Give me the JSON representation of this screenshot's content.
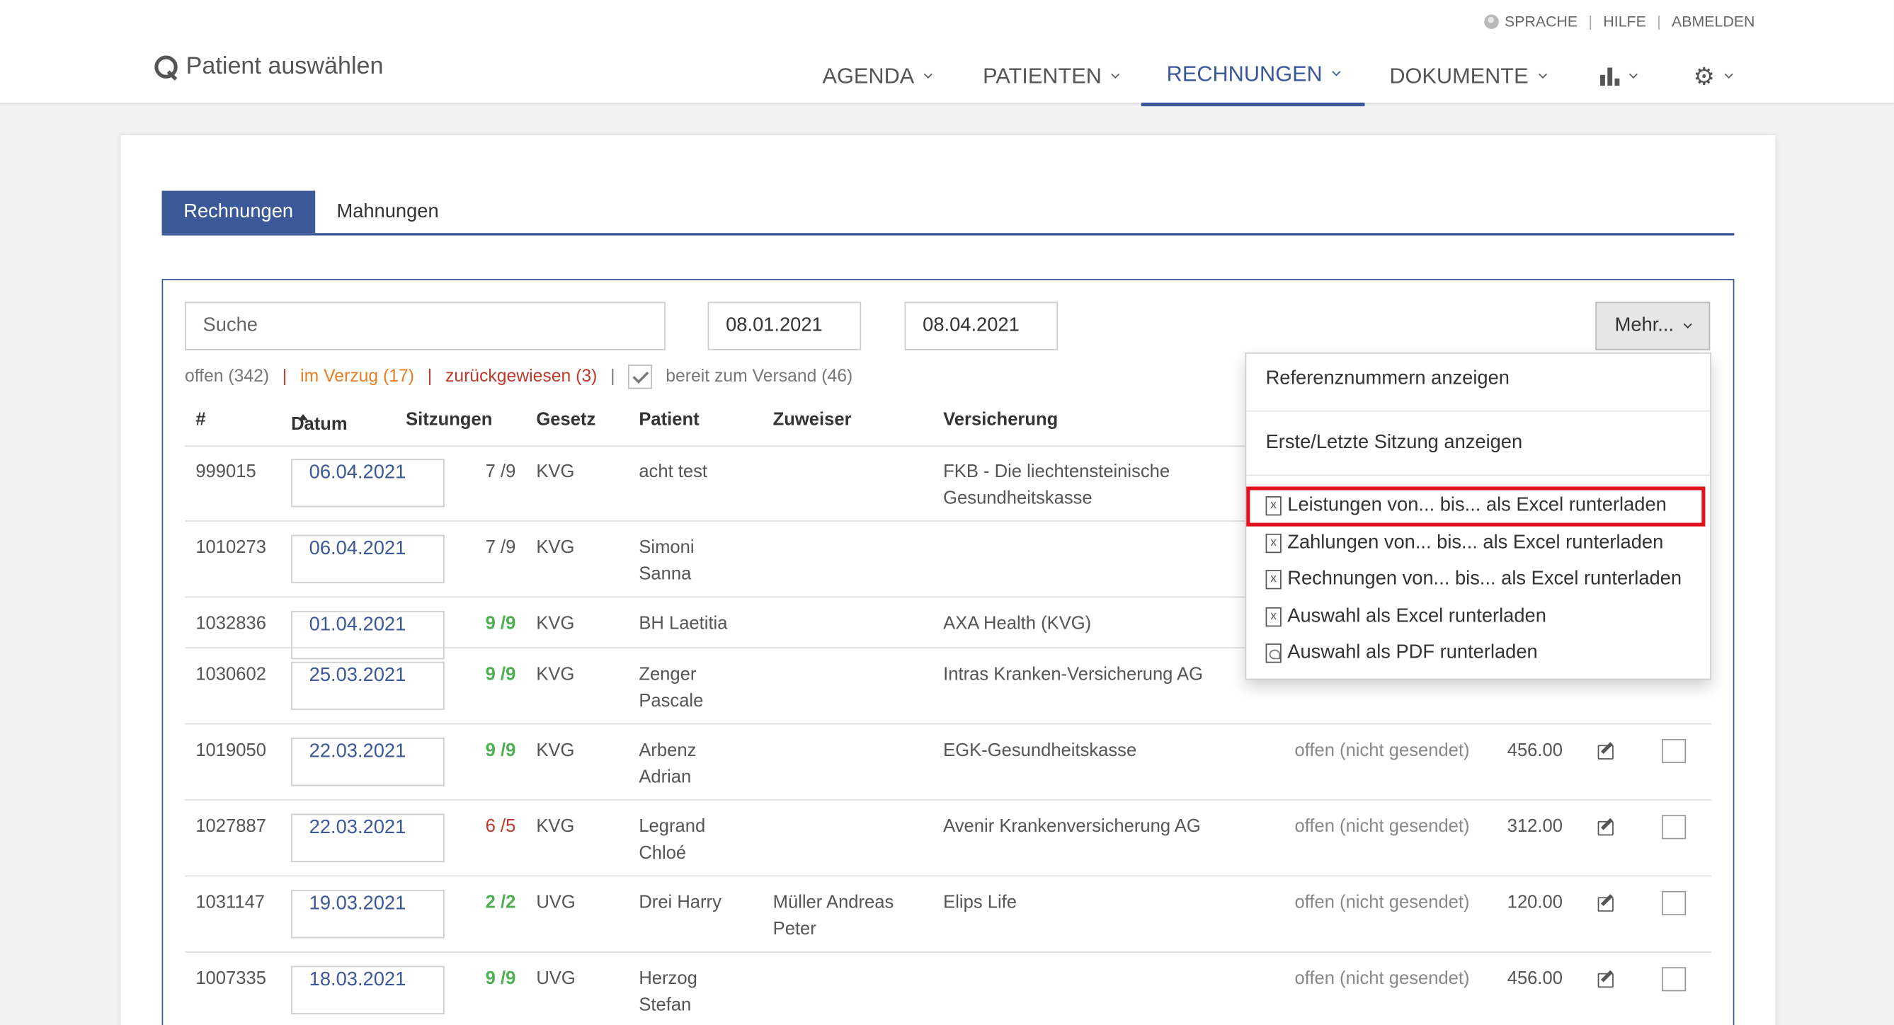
{
  "utility": {
    "language": "SPRACHE",
    "help": "HILFE",
    "logout": "ABMELDEN"
  },
  "patient_select": "Patient auswählen",
  "nav": {
    "agenda": "AGENDA",
    "patients": "PATIENTEN",
    "invoices": "RECHNUNGEN",
    "documents": "DOKUMENTE"
  },
  "tabs": {
    "invoices": "Rechnungen",
    "reminders": "Mahnungen"
  },
  "search": {
    "placeholder": "Suche"
  },
  "date_from": "08.01.2021",
  "date_to": "08.04.2021",
  "more_button": "Mehr...",
  "filters": {
    "open": "offen (342)",
    "overdue": "im Verzug (17)",
    "rejected": "zurückgewiesen (3)",
    "ready": "bereit zum Versand (46)"
  },
  "columns": {
    "number": "#",
    "date": "Datum",
    "sessions": "Sitzungen",
    "law": "Gesetz",
    "patient": "Patient",
    "referrer": "Zuweiser",
    "insurance": "Versicherung"
  },
  "rows": [
    {
      "number": "999015",
      "date": "06.04.2021",
      "sessions": "7 /9",
      "law": "KVG",
      "patient1": "acht test",
      "patient2": "",
      "referrer1": "",
      "referrer2": "",
      "insurance1": "FKB - Die liechtensteinische",
      "insurance2": "Gesundheitskasse",
      "status": "",
      "amount": ""
    },
    {
      "number": "1010273",
      "date": "06.04.2021",
      "sessions": "7 /9",
      "law": "KVG",
      "patient1": "Simoni",
      "patient2": "Sanna",
      "referrer1": "",
      "referrer2": "",
      "insurance1": "",
      "insurance2": "",
      "status": "",
      "amount": ""
    },
    {
      "number": "1032836",
      "date": "01.04.2021",
      "sessions": "9 /9",
      "law": "KVG",
      "patient1": "BH Laetitia",
      "patient2": "",
      "referrer1": "",
      "referrer2": "",
      "insurance1": "AXA Health (KVG)",
      "insurance2": "",
      "status": "",
      "amount": ""
    },
    {
      "number": "1030602",
      "date": "25.03.2021",
      "sessions": "9 /9",
      "law": "KVG",
      "patient1": "Zenger",
      "patient2": "Pascale",
      "referrer1": "",
      "referrer2": "",
      "insurance1": "Intras Kranken-Versicherung AG",
      "insurance2": "",
      "status": "",
      "amount": ""
    },
    {
      "number": "1019050",
      "date": "22.03.2021",
      "sessions": "9 /9",
      "law": "KVG",
      "patient1": "Arbenz",
      "patient2": "Adrian",
      "referrer1": "",
      "referrer2": "",
      "insurance1": "EGK-Gesundheitskasse",
      "insurance2": "",
      "status": "offen (nicht gesendet)",
      "amount": "456.00"
    },
    {
      "number": "1027887",
      "date": "22.03.2021",
      "sessions": "6 /5",
      "law": "KVG",
      "patient1": "Legrand",
      "patient2": "Chloé",
      "referrer1": "",
      "referrer2": "",
      "insurance1": "Avenir Krankenversicherung AG",
      "insurance2": "",
      "status": "offen (nicht gesendet)",
      "amount": "312.00"
    },
    {
      "number": "1031147",
      "date": "19.03.2021",
      "sessions": "2 /2",
      "law": "UVG",
      "patient1": "Drei Harry",
      "patient2": "",
      "referrer1": "Müller Andreas",
      "referrer2": "Peter",
      "insurance1": "Elips Life",
      "insurance2": "",
      "status": "offen (nicht gesendet)",
      "amount": "120.00"
    },
    {
      "number": "1007335",
      "date": "18.03.2021",
      "sessions": "9 /9",
      "law": "UVG",
      "patient1": "Herzog",
      "patient2": "Stefan",
      "referrer1": "",
      "referrer2": "",
      "insurance1": "",
      "insurance2": "",
      "status": "offen (nicht gesendet)",
      "amount": "456.00"
    }
  ],
  "dropdown": {
    "show_references": "Referenznummern anzeigen",
    "show_first_last": "Erste/Letzte Sitzung anzeigen",
    "services_excel": "Leistungen von... bis... als Excel runterladen",
    "payments_excel": "Zahlungen von... bis... als Excel runterladen",
    "invoices_excel": "Rechnungen von... bis... als Excel runterladen",
    "selection_excel": "Auswahl als Excel runterladen",
    "selection_pdf": "Auswahl als PDF runterladen"
  },
  "colors": {
    "accent": "#3b5998",
    "ok": "#4caf50",
    "error": "#c0392b",
    "warning": "#e67e22",
    "highlight": "#e0121e"
  }
}
